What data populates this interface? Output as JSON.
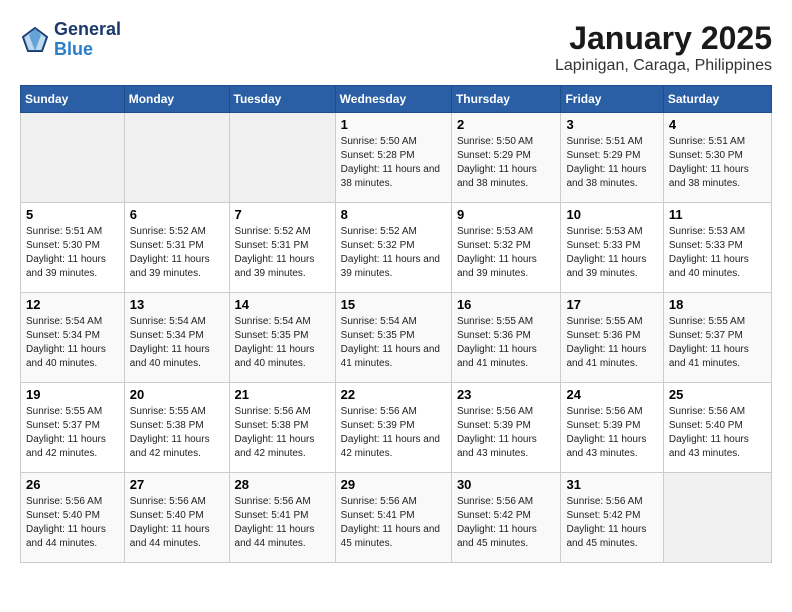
{
  "header": {
    "logo_line1": "General",
    "logo_line2": "Blue",
    "month": "January 2025",
    "location": "Lapinigan, Caraga, Philippines"
  },
  "weekdays": [
    "Sunday",
    "Monday",
    "Tuesday",
    "Wednesday",
    "Thursday",
    "Friday",
    "Saturday"
  ],
  "weeks": [
    [
      {
        "day": "",
        "info": ""
      },
      {
        "day": "",
        "info": ""
      },
      {
        "day": "",
        "info": ""
      },
      {
        "day": "1",
        "info": "Sunrise: 5:50 AM\nSunset: 5:28 PM\nDaylight: 11 hours and 38 minutes."
      },
      {
        "day": "2",
        "info": "Sunrise: 5:50 AM\nSunset: 5:29 PM\nDaylight: 11 hours and 38 minutes."
      },
      {
        "day": "3",
        "info": "Sunrise: 5:51 AM\nSunset: 5:29 PM\nDaylight: 11 hours and 38 minutes."
      },
      {
        "day": "4",
        "info": "Sunrise: 5:51 AM\nSunset: 5:30 PM\nDaylight: 11 hours and 38 minutes."
      }
    ],
    [
      {
        "day": "5",
        "info": "Sunrise: 5:51 AM\nSunset: 5:30 PM\nDaylight: 11 hours and 39 minutes."
      },
      {
        "day": "6",
        "info": "Sunrise: 5:52 AM\nSunset: 5:31 PM\nDaylight: 11 hours and 39 minutes."
      },
      {
        "day": "7",
        "info": "Sunrise: 5:52 AM\nSunset: 5:31 PM\nDaylight: 11 hours and 39 minutes."
      },
      {
        "day": "8",
        "info": "Sunrise: 5:52 AM\nSunset: 5:32 PM\nDaylight: 11 hours and 39 minutes."
      },
      {
        "day": "9",
        "info": "Sunrise: 5:53 AM\nSunset: 5:32 PM\nDaylight: 11 hours and 39 minutes."
      },
      {
        "day": "10",
        "info": "Sunrise: 5:53 AM\nSunset: 5:33 PM\nDaylight: 11 hours and 39 minutes."
      },
      {
        "day": "11",
        "info": "Sunrise: 5:53 AM\nSunset: 5:33 PM\nDaylight: 11 hours and 40 minutes."
      }
    ],
    [
      {
        "day": "12",
        "info": "Sunrise: 5:54 AM\nSunset: 5:34 PM\nDaylight: 11 hours and 40 minutes."
      },
      {
        "day": "13",
        "info": "Sunrise: 5:54 AM\nSunset: 5:34 PM\nDaylight: 11 hours and 40 minutes."
      },
      {
        "day": "14",
        "info": "Sunrise: 5:54 AM\nSunset: 5:35 PM\nDaylight: 11 hours and 40 minutes."
      },
      {
        "day": "15",
        "info": "Sunrise: 5:54 AM\nSunset: 5:35 PM\nDaylight: 11 hours and 41 minutes."
      },
      {
        "day": "16",
        "info": "Sunrise: 5:55 AM\nSunset: 5:36 PM\nDaylight: 11 hours and 41 minutes."
      },
      {
        "day": "17",
        "info": "Sunrise: 5:55 AM\nSunset: 5:36 PM\nDaylight: 11 hours and 41 minutes."
      },
      {
        "day": "18",
        "info": "Sunrise: 5:55 AM\nSunset: 5:37 PM\nDaylight: 11 hours and 41 minutes."
      }
    ],
    [
      {
        "day": "19",
        "info": "Sunrise: 5:55 AM\nSunset: 5:37 PM\nDaylight: 11 hours and 42 minutes."
      },
      {
        "day": "20",
        "info": "Sunrise: 5:55 AM\nSunset: 5:38 PM\nDaylight: 11 hours and 42 minutes."
      },
      {
        "day": "21",
        "info": "Sunrise: 5:56 AM\nSunset: 5:38 PM\nDaylight: 11 hours and 42 minutes."
      },
      {
        "day": "22",
        "info": "Sunrise: 5:56 AM\nSunset: 5:39 PM\nDaylight: 11 hours and 42 minutes."
      },
      {
        "day": "23",
        "info": "Sunrise: 5:56 AM\nSunset: 5:39 PM\nDaylight: 11 hours and 43 minutes."
      },
      {
        "day": "24",
        "info": "Sunrise: 5:56 AM\nSunset: 5:39 PM\nDaylight: 11 hours and 43 minutes."
      },
      {
        "day": "25",
        "info": "Sunrise: 5:56 AM\nSunset: 5:40 PM\nDaylight: 11 hours and 43 minutes."
      }
    ],
    [
      {
        "day": "26",
        "info": "Sunrise: 5:56 AM\nSunset: 5:40 PM\nDaylight: 11 hours and 44 minutes."
      },
      {
        "day": "27",
        "info": "Sunrise: 5:56 AM\nSunset: 5:40 PM\nDaylight: 11 hours and 44 minutes."
      },
      {
        "day": "28",
        "info": "Sunrise: 5:56 AM\nSunset: 5:41 PM\nDaylight: 11 hours and 44 minutes."
      },
      {
        "day": "29",
        "info": "Sunrise: 5:56 AM\nSunset: 5:41 PM\nDaylight: 11 hours and 45 minutes."
      },
      {
        "day": "30",
        "info": "Sunrise: 5:56 AM\nSunset: 5:42 PM\nDaylight: 11 hours and 45 minutes."
      },
      {
        "day": "31",
        "info": "Sunrise: 5:56 AM\nSunset: 5:42 PM\nDaylight: 11 hours and 45 minutes."
      },
      {
        "day": "",
        "info": ""
      }
    ]
  ]
}
